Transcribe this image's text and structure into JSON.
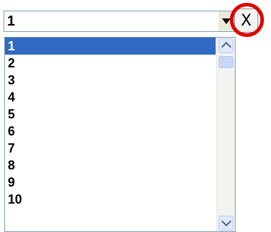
{
  "combo": {
    "value": "1"
  },
  "clear_button": {
    "label": "X"
  },
  "list": {
    "items": [
      "1",
      "2",
      "3",
      "4",
      "5",
      "6",
      "7",
      "8",
      "9",
      "10"
    ],
    "selected_index": 0
  },
  "colors": {
    "selection": "#316ac5",
    "highlight_ring": "#e00000"
  },
  "icons": {
    "dropdown": "chevron-down-icon",
    "scroll_up": "scroll-up-icon",
    "scroll_down": "scroll-down-icon"
  }
}
